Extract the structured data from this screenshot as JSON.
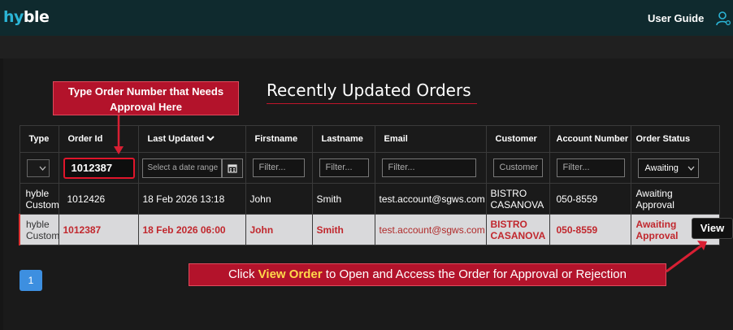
{
  "header": {
    "logo_hy": "hy",
    "logo_ble": "ble",
    "user_guide": "User Guide",
    "user_icon": "user-settings-icon"
  },
  "page": {
    "title": "Recently Updated Orders"
  },
  "callouts": {
    "top": "Type Order Number that Needs Approval Here",
    "bottom_pre": "Click ",
    "bottom_hl": "View Order",
    "bottom_post": " to Open and Access the Order for Approval or Rejection"
  },
  "table": {
    "columns": [
      "Type",
      "Order Id",
      "Last Updated",
      "Firstname",
      "Lastname",
      "Email",
      "Customer",
      "Account Number",
      "Order Status"
    ],
    "filters": {
      "order_id_value": "1012387",
      "date_placeholder": "Select a date range",
      "firstname_placeholder": "Filter...",
      "lastname_placeholder": "Filter...",
      "email_placeholder": "Filter...",
      "customer_placeholder": "Customer",
      "account_placeholder": "Filter...",
      "status_value": "Awaiting"
    },
    "rows": [
      {
        "type_l1": "hyble",
        "type_l2": "Custom",
        "order_id": "1012426",
        "updated": "18 Feb 2026 13:18",
        "firstname": "John",
        "lastname": "Smith",
        "email": "test.account@sgws.com",
        "customer_l1": "BISTRO",
        "customer_l2": "CASANOVA",
        "account": "050-8559",
        "status_l1": "Awaiting",
        "status_l2": "Approval"
      },
      {
        "type_l1": "hyble",
        "type_l2": "Custom",
        "order_id": "1012387",
        "updated": "18 Feb 2026 06:00",
        "firstname": "John",
        "lastname": "Smith",
        "email": "test.account@sgws.com",
        "customer_l1": "BISTRO",
        "customer_l2": "CASANOVA",
        "account": "050-8559",
        "status_l1": "Awaiting",
        "status_l2": "Approval"
      }
    ]
  },
  "actions": {
    "view_label": "View"
  },
  "pagination": {
    "current": "1"
  },
  "colors": {
    "accent": "#b3132b",
    "page_btn": "#3d8fe0",
    "header_bg": "#0f2a2e"
  }
}
